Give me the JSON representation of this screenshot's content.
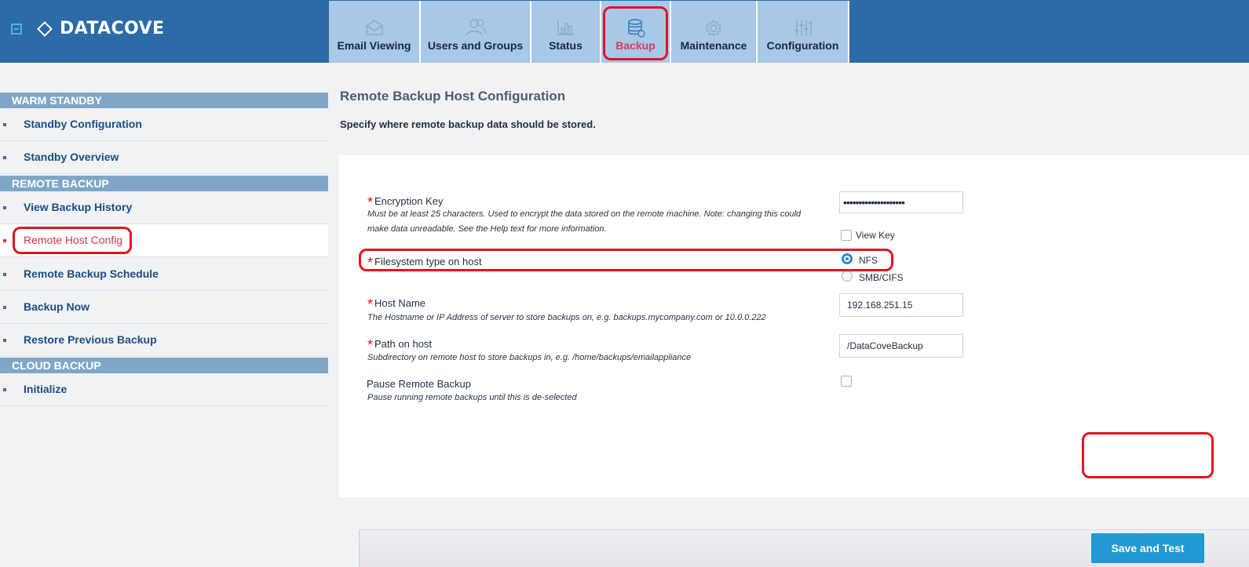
{
  "header": {
    "brand": "DATACOVE",
    "tabs": [
      {
        "label": "Email Viewing",
        "icon": "envelope-icon"
      },
      {
        "label": "Users and Groups",
        "icon": "users-icon"
      },
      {
        "label": "Status",
        "icon": "bar-chart-icon"
      },
      {
        "label": "Backup",
        "icon": "database-icon",
        "active": true
      },
      {
        "label": "Maintenance",
        "icon": "gear-icon"
      },
      {
        "label": "Configuration",
        "icon": "sliders-icon"
      }
    ]
  },
  "sidebar": {
    "sections": [
      {
        "title": "WARM STANDBY",
        "items": [
          {
            "label": "Standby Configuration"
          },
          {
            "label": "Standby Overview"
          }
        ]
      },
      {
        "title": "REMOTE BACKUP",
        "items": [
          {
            "label": "View Backup History"
          },
          {
            "label": "Remote Host Config",
            "active": true
          },
          {
            "label": "Remote Backup Schedule"
          },
          {
            "label": "Backup Now"
          },
          {
            "label": "Restore Previous Backup"
          }
        ]
      },
      {
        "title": "CLOUD BACKUP",
        "items": [
          {
            "label": "Initialize"
          }
        ]
      }
    ]
  },
  "main": {
    "title": "Remote Backup Host Configuration",
    "subtitle": "Specify where remote backup data should be stored.",
    "fields": {
      "encryption_key": {
        "required_mark": "*",
        "label": "Encryption Key",
        "help_line1": "Must be at least 25 characters. Used to encrypt the data stored on the remote machine. Note: changing this could",
        "help_line2": "make data unreadable. See the Help text for more information.",
        "value": "••••••••••••••••••••",
        "view_key_label": "View Key"
      },
      "filesystem": {
        "required_mark": "*",
        "label": "Filesystem type on host",
        "options": [
          {
            "label": "NFS",
            "selected": true
          },
          {
            "label": "SMB/CIFS",
            "selected": false
          }
        ]
      },
      "host_name": {
        "required_mark": "*",
        "label": "Host Name",
        "help": "The Hostname or IP Address of server to store backups on, e.g. backups.mycompany.com or 10.0.0.222",
        "value": "192.168.251.15"
      },
      "path": {
        "required_mark": "*",
        "label": "Path on host",
        "help": "Subdirectory on remote host to store backups in, e.g. /home/backups/emailappliance",
        "value": "/DataCoveBackup"
      },
      "pause": {
        "label": "Pause Remote Backup",
        "help": "Pause running remote backups until this is de-selected",
        "checked": false
      }
    },
    "save_button": "Save and Test"
  },
  "colors": {
    "header_bg": "#2d6aa8",
    "tab_bg": "#a8c8e8",
    "section_header_bg": "#7ea7c7",
    "accent_red": "#e21323",
    "button_blue": "#2199d2"
  }
}
